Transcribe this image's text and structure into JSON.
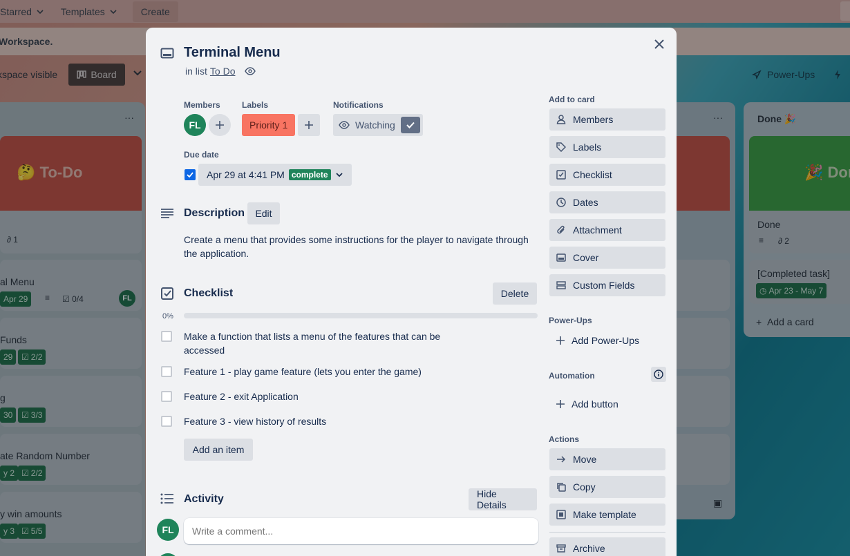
{
  "header": {
    "starred_label": "Starred",
    "templates_label": "Templates",
    "create_label": "Create"
  },
  "banner": {
    "text": "Workspace."
  },
  "boardbar": {
    "visibility": "kspace visible",
    "board_label": "Board",
    "powerups_label": "Power-Ups"
  },
  "background": {
    "left_list": {
      "cover_title": "To-Do",
      "count_badge": "1",
      "cards": [
        {
          "title": "al Menu",
          "date": "Apr 29",
          "checklist": "0/4",
          "member": "FL"
        },
        {
          "title": "Funds",
          "date": "29",
          "checklist": "2/2"
        },
        {
          "title": "g",
          "date": "30",
          "checklist": "3/3"
        },
        {
          "title": "ate Random Number",
          "date": "y 2",
          "checklist": "2/2"
        },
        {
          "title": "y win amounts",
          "date": "y 3",
          "checklist": "5/5"
        }
      ]
    },
    "done_list": {
      "title": "Done",
      "cover_title": "Dor",
      "cards": [
        {
          "title": "Done",
          "attachments": "2"
        },
        {
          "title": "[Completed task]",
          "date": "Apr 23 - May 7"
        }
      ],
      "add_card": "Add a card"
    }
  },
  "card": {
    "title": "Terminal Menu",
    "in_list_prefix": "in list",
    "list_name": "To Do",
    "members_label": "Members",
    "member_initials": "FL",
    "labels_label": "Labels",
    "label_name": "Priority 1",
    "notifications_label": "Notifications",
    "watching_label": "Watching",
    "due_label": "Due date",
    "due_value": "Apr 29 at 4:41 PM",
    "due_status": "complete",
    "description": {
      "heading": "Description",
      "edit_label": "Edit",
      "text": "Create a menu that provides some instructions for the player to navigate through the application."
    },
    "checklist": {
      "heading": "Checklist",
      "delete_label": "Delete",
      "progress_text": "0%",
      "progress": 0,
      "items": [
        "Make a function that lists a menu of the features that can be accessed",
        "Feature 1 - play game feature (lets you enter the game)",
        "Feature 2 - exit Application",
        "Feature 3 - view history of results"
      ],
      "add_item_label": "Add an item"
    },
    "activity": {
      "heading": "Activity",
      "hide_details_label": "Hide Details",
      "comment_placeholder": "Write a comment...",
      "avatar": "FL"
    }
  },
  "sidebar": {
    "add_to_card_label": "Add to card",
    "add_to_card": [
      "Members",
      "Labels",
      "Checklist",
      "Dates",
      "Attachment",
      "Cover",
      "Custom Fields"
    ],
    "powerups_label": "Power-Ups",
    "add_powerups": "Add Power-Ups",
    "automation_label": "Automation",
    "add_button": "Add button",
    "actions_label": "Actions",
    "actions": [
      "Move",
      "Copy",
      "Make template",
      "Archive"
    ]
  },
  "colors": {
    "label_priority": "#f87462",
    "member_avatar": "#1f845a",
    "complete_badge": "#1f845a",
    "checkbox_checked": "#0c66e4"
  }
}
